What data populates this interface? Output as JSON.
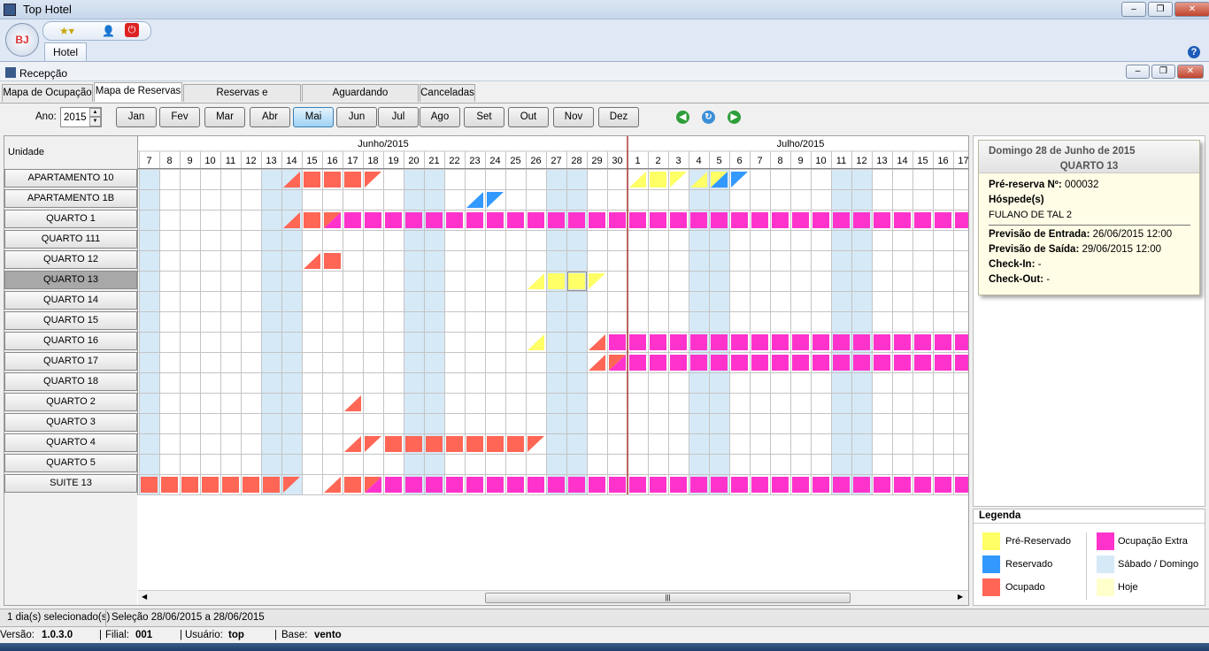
{
  "window": {
    "title": "Top Hotel",
    "minimize": "–",
    "restore": "❐",
    "close": "✕"
  },
  "ribbon": {
    "orb": "BJ",
    "tab": "Hotel",
    "help": "?",
    "qat_icons": [
      "favorites-icon",
      "user-login-icon",
      "power-icon"
    ]
  },
  "doc": {
    "title": "Recepção"
  },
  "tabs": [
    "Mapa de Ocupação",
    "Mapa de Reservas",
    "Reservas e Hospedagens",
    "Aguardando Confirmação",
    "Canceladas"
  ],
  "active_tab": 1,
  "toolbar": {
    "year_label": "Ano:",
    "year": "2015",
    "months": [
      "Jan",
      "Fev",
      "Mar",
      "Abr",
      "Mai",
      "Jun",
      "Jul",
      "Ago",
      "Set",
      "Out",
      "Nov",
      "Dez"
    ],
    "selected_month": 4
  },
  "grid": {
    "unit_header": "Unidade",
    "months": [
      {
        "label": "Junho/2015",
        "days": 24
      },
      {
        "label": "Julho/2015",
        "days": 17
      }
    ],
    "days": [
      7,
      8,
      9,
      10,
      11,
      12,
      13,
      14,
      15,
      16,
      17,
      18,
      19,
      20,
      21,
      22,
      23,
      24,
      25,
      26,
      27,
      28,
      29,
      30,
      1,
      2,
      3,
      4,
      5,
      6,
      7,
      8,
      9,
      10,
      11,
      12,
      13,
      14,
      15,
      16,
      17
    ],
    "weekend_cols": [
      0,
      6,
      7,
      13,
      14,
      20,
      21,
      27,
      28,
      34,
      35
    ],
    "today_col": 21,
    "selected_col": 21,
    "month_divider_col": 24,
    "units": [
      "APARTAMENTO 10",
      "APARTAMENTO 1B",
      "QUARTO 1",
      "QUARTO 111",
      "QUARTO 12",
      "QUARTO 13",
      "QUARTO 14",
      "QUARTO 15",
      "QUARTO 16",
      "QUARTO 17",
      "QUARTO 18",
      "QUARTO 2",
      "QUARTO 3",
      "QUARTO 4",
      "QUARTO 5",
      "SUITE 13"
    ],
    "selected_unit": 5,
    "cells": [
      {
        "r": 0,
        "c": 7,
        "k": "o",
        "s": "end"
      },
      {
        "r": 0,
        "c": 8,
        "k": "o",
        "s": "full"
      },
      {
        "r": 0,
        "c": 9,
        "k": "o",
        "s": "full"
      },
      {
        "r": 0,
        "c": 10,
        "k": "o",
        "s": "full"
      },
      {
        "r": 0,
        "c": 11,
        "k": "o",
        "s": "start"
      },
      {
        "r": 0,
        "c": 24,
        "k": "p",
        "s": "end"
      },
      {
        "r": 0,
        "c": 25,
        "k": "p",
        "s": "full"
      },
      {
        "r": 0,
        "c": 26,
        "k": "p",
        "s": "start"
      },
      {
        "r": 0,
        "c": 27,
        "k": "p",
        "s": "end"
      },
      {
        "r": 0,
        "c": 28,
        "k": "p",
        "s": "split",
        "k2": "r"
      },
      {
        "r": 0,
        "c": 29,
        "k": "r",
        "s": "start"
      },
      {
        "r": 1,
        "c": 16,
        "k": "r",
        "s": "end"
      },
      {
        "r": 1,
        "c": 17,
        "k": "r",
        "s": "start"
      },
      {
        "r": 2,
        "c": 7,
        "k": "o",
        "s": "end"
      },
      {
        "r": 2,
        "c": 8,
        "k": "o",
        "s": "full"
      },
      {
        "r": 2,
        "c": 9,
        "k": "o",
        "s": "split",
        "k2": "x"
      },
      {
        "r": 4,
        "c": 8,
        "k": "o",
        "s": "end"
      },
      {
        "r": 4,
        "c": 9,
        "k": "o",
        "s": "full"
      },
      {
        "r": 5,
        "c": 19,
        "k": "p",
        "s": "end"
      },
      {
        "r": 5,
        "c": 20,
        "k": "p",
        "s": "full"
      },
      {
        "r": 5,
        "c": 21,
        "k": "p",
        "s": "full"
      },
      {
        "r": 5,
        "c": 22,
        "k": "p",
        "s": "start"
      },
      {
        "r": 8,
        "c": 19,
        "k": "p",
        "s": "end"
      },
      {
        "r": 8,
        "c": 22,
        "k": "o",
        "s": "end"
      },
      {
        "r": 9,
        "c": 22,
        "k": "o",
        "s": "end"
      },
      {
        "r": 9,
        "c": 23,
        "k": "o",
        "s": "split",
        "k2": "x"
      },
      {
        "r": 11,
        "c": 10,
        "k": "o",
        "s": "end"
      },
      {
        "r": 13,
        "c": 10,
        "k": "o",
        "s": "end"
      },
      {
        "r": 13,
        "c": 11,
        "k": "o",
        "s": "start"
      },
      {
        "r": 13,
        "c": 12,
        "k": "o",
        "s": "full"
      },
      {
        "r": 13,
        "c": 13,
        "k": "o",
        "s": "full"
      },
      {
        "r": 13,
        "c": 14,
        "k": "o",
        "s": "full"
      },
      {
        "r": 13,
        "c": 15,
        "k": "o",
        "s": "full"
      },
      {
        "r": 13,
        "c": 16,
        "k": "o",
        "s": "full"
      },
      {
        "r": 13,
        "c": 17,
        "k": "o",
        "s": "full"
      },
      {
        "r": 13,
        "c": 18,
        "k": "o",
        "s": "full"
      },
      {
        "r": 13,
        "c": 19,
        "k": "o",
        "s": "start"
      },
      {
        "r": 15,
        "c": 0,
        "k": "o",
        "s": "full"
      },
      {
        "r": 15,
        "c": 1,
        "k": "o",
        "s": "full"
      },
      {
        "r": 15,
        "c": 2,
        "k": "o",
        "s": "full"
      },
      {
        "r": 15,
        "c": 3,
        "k": "o",
        "s": "full"
      },
      {
        "r": 15,
        "c": 4,
        "k": "o",
        "s": "full"
      },
      {
        "r": 15,
        "c": 5,
        "k": "o",
        "s": "full"
      },
      {
        "r": 15,
        "c": 6,
        "k": "o",
        "s": "full"
      },
      {
        "r": 15,
        "c": 7,
        "k": "o",
        "s": "start"
      },
      {
        "r": 15,
        "c": 9,
        "k": "o",
        "s": "end"
      },
      {
        "r": 15,
        "c": 10,
        "k": "o",
        "s": "full"
      },
      {
        "r": 15,
        "c": 11,
        "k": "o",
        "s": "split",
        "k2": "x"
      }
    ],
    "extra_runs": [
      {
        "r": 2,
        "from": 10,
        "to": 40
      },
      {
        "r": 8,
        "from": 23,
        "to": 40
      },
      {
        "r": 9,
        "from": 24,
        "to": 40
      },
      {
        "r": 15,
        "from": 12,
        "to": 40
      }
    ]
  },
  "popup": {
    "date": "Domingo 28 de Junho de 2015",
    "room": "QUARTO 13",
    "pre_label": "Pré-reserva Nº:",
    "pre_value": "000032",
    "guests_label": "Hóspede(s)",
    "guest": "FULANO DE TAL 2",
    "in_label": "Previsão de Entrada:",
    "in_value": "26/06/2015 12:00",
    "out_label": "Previsão de Saída:",
    "out_value": "29/06/2015 12:00",
    "checkin_label": "Check-In:",
    "checkin_value": "-",
    "checkout_label": "Check-Out:",
    "checkout_value": "-"
  },
  "legend": {
    "title": "Legenda",
    "items": [
      {
        "label": "Pré-Reservado",
        "color": "#ffff66"
      },
      {
        "label": "Reservado",
        "color": "#3399ff"
      },
      {
        "label": "Ocupado",
        "color": "#ff6655"
      },
      {
        "label": "Ocupação Extra",
        "color": "#ff33cc"
      },
      {
        "label": "Sábado / Domingo",
        "color": "#d6e9f7"
      },
      {
        "label": "Hoje",
        "color": "#ffffcc"
      }
    ]
  },
  "colors": {
    "p": "#ffff66",
    "r": "#3399ff",
    "o": "#ff6655",
    "x": "#ff33cc",
    "weekend": "#d6e9f7",
    "today": "#ffffcc",
    "grid": "#c4c4c4",
    "divider": "#b03a3a"
  },
  "status": {
    "days_selected": "1 dia(s) selecionado(s)",
    "selection": "Seleção 28/06/2015 a 28/06/2015"
  },
  "footer": {
    "version_label": "Versão:",
    "version": "1.0.3.0",
    "branch_label": "Filial:",
    "branch": "001",
    "user_label": "Usuário:",
    "user": "top",
    "base_label": "Base:",
    "base": "vento"
  }
}
